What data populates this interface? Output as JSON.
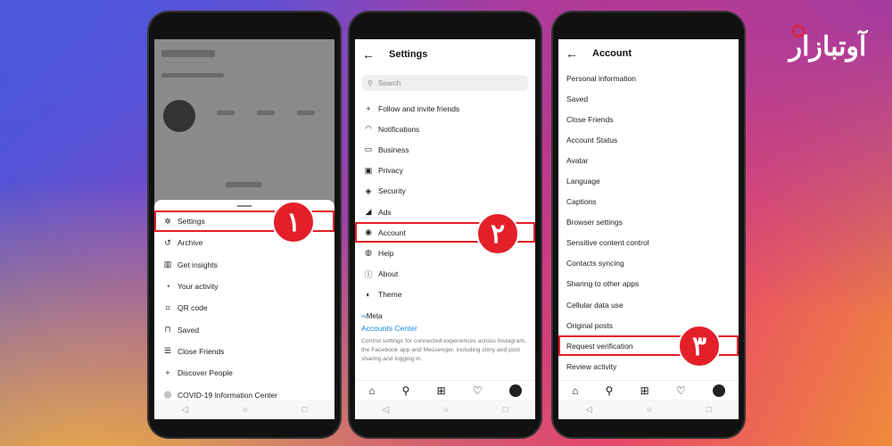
{
  "logo_text": "آوتبازار",
  "colors": {
    "highlight": "#e3202a",
    "link": "#1b8ae0"
  },
  "phone1": {
    "step": "١",
    "menu": [
      {
        "icon": "settings-icon",
        "glyph": "✲",
        "label": "Settings"
      },
      {
        "icon": "archive-icon",
        "glyph": "↺",
        "label": "Archive"
      },
      {
        "icon": "insights-icon",
        "glyph": "▥",
        "label": "Get insights"
      },
      {
        "icon": "activity-icon",
        "glyph": "◔",
        "label": "Your activity"
      },
      {
        "icon": "qr-icon",
        "glyph": "⌗",
        "label": "QR code"
      },
      {
        "icon": "bookmark-icon",
        "glyph": "⊓",
        "label": "Saved"
      },
      {
        "icon": "list-icon",
        "glyph": "☰",
        "label": "Close Friends"
      },
      {
        "icon": "add-person-icon",
        "glyph": "+",
        "label": "Discover People"
      },
      {
        "icon": "info-icon",
        "glyph": "◎",
        "label": "COVID-19 Information Center"
      }
    ]
  },
  "phone2": {
    "step": "٢",
    "title": "Settings",
    "search_placeholder": "Search",
    "menu": [
      {
        "icon": "add-person-icon",
        "glyph": "+",
        "label": "Follow and invite friends"
      },
      {
        "icon": "bell-icon",
        "glyph": "◠",
        "label": "Notifications"
      },
      {
        "icon": "shop-icon",
        "glyph": "▭",
        "label": "Business"
      },
      {
        "icon": "lock-icon",
        "glyph": "▣",
        "label": "Privacy"
      },
      {
        "icon": "shield-icon",
        "glyph": "◈",
        "label": "Security"
      },
      {
        "icon": "ads-icon",
        "glyph": "◢",
        "label": "Ads"
      },
      {
        "icon": "account-icon",
        "glyph": "◉",
        "label": "Account"
      },
      {
        "icon": "help-icon",
        "glyph": "◍",
        "label": "Help"
      },
      {
        "icon": "about-icon",
        "glyph": "ⓘ",
        "label": "About"
      },
      {
        "icon": "theme-icon",
        "glyph": "◐",
        "label": "Theme"
      }
    ],
    "meta_label": "Meta",
    "accounts_center": "Accounts Center",
    "description": "Control settings for connected experiences across Instagram, the Facebook app and Messenger, including story and post sharing and logging in."
  },
  "phone3": {
    "step": "٣",
    "title": "Account",
    "menu": [
      "Personal information",
      "Saved",
      "Close Friends",
      "Account Status",
      "Avatar",
      "Language",
      "Captions",
      "Browser settings",
      "Sensitive content control",
      "Contacts syncing",
      "Sharing to other apps",
      "Cellular data use",
      "Original posts",
      "Request verification",
      "Review activity"
    ]
  },
  "nav": {
    "home": "⌂",
    "search": "⚲",
    "add": "⊞",
    "heart": "♡"
  },
  "sys": {
    "back": "◁",
    "home": "○",
    "recent": "□"
  }
}
